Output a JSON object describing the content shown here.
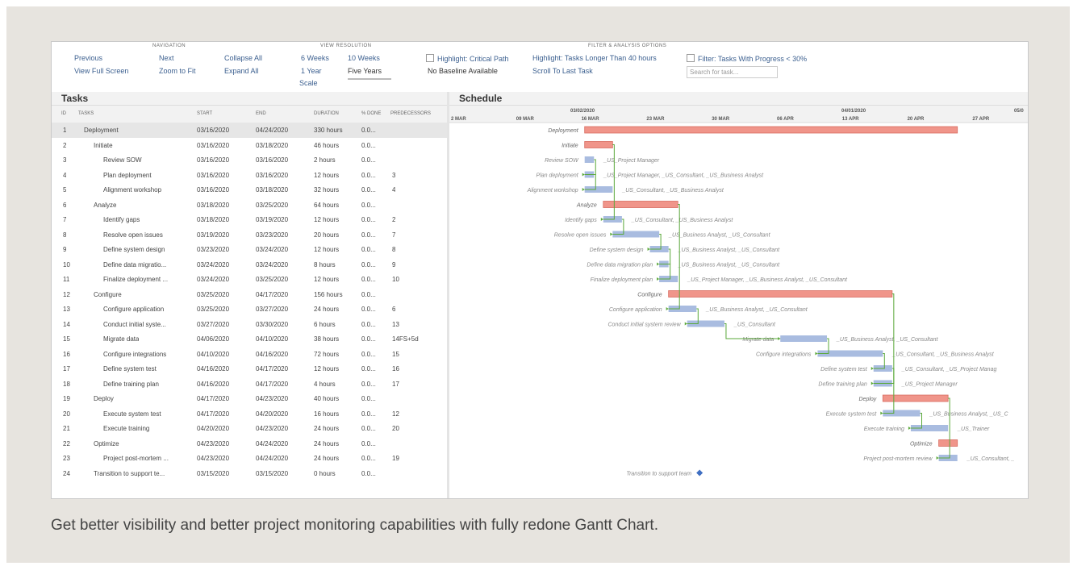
{
  "toolbar": {
    "navigation_title": "NAVIGATION",
    "previous": "Previous",
    "next": "Next",
    "view_full_screen": "View Full Screen",
    "zoom_to_fit": "Zoom to Fit",
    "collapse_all": "Collapse All",
    "expand_all": "Expand All",
    "view_resolution_title": "VIEW RESOLUTION",
    "six_weeks": "6 Weeks",
    "ten_weeks": "10 Weeks",
    "one_year": "1 Year",
    "five_years": "Five Years",
    "scale": "Scale",
    "filter_title": "FILTER & ANALYSIS OPTIONS",
    "highlight_critical": "Highlight: Critical Path",
    "highlight_longer": "Highlight: Tasks Longer Than 40 hours",
    "filter_progress": "Filter: Tasks With Progress < 30%",
    "no_baseline": "No Baseline Available",
    "scroll_last_task": "Scroll To Last Task",
    "search_placeholder": "Search for task..."
  },
  "tasks_header": "Tasks",
  "schedule_header": "Schedule",
  "columns": {
    "id": "ID",
    "tasks": "TASKS",
    "start": "START",
    "end": "END",
    "duration": "DURATION",
    "pct": "% DONE",
    "pred": "PREDECESSORS"
  },
  "tasks": [
    {
      "id": "1",
      "name": "Deployment",
      "indent": 0,
      "start": "03/16/2020",
      "end": "04/24/2020",
      "duration": "330 hours",
      "pct": "0.0...",
      "pred": ""
    },
    {
      "id": "2",
      "name": "Initiate",
      "indent": 1,
      "start": "03/16/2020",
      "end": "03/18/2020",
      "duration": "46 hours",
      "pct": "0.0...",
      "pred": ""
    },
    {
      "id": "3",
      "name": "Review SOW",
      "indent": 2,
      "start": "03/16/2020",
      "end": "03/16/2020",
      "duration": "2 hours",
      "pct": "0.0...",
      "pred": ""
    },
    {
      "id": "4",
      "name": "Plan deployment",
      "indent": 2,
      "start": "03/16/2020",
      "end": "03/16/2020",
      "duration": "12 hours",
      "pct": "0.0...",
      "pred": "3"
    },
    {
      "id": "5",
      "name": "Alignment workshop",
      "indent": 2,
      "start": "03/16/2020",
      "end": "03/18/2020",
      "duration": "32 hours",
      "pct": "0.0...",
      "pred": "4"
    },
    {
      "id": "6",
      "name": "Analyze",
      "indent": 1,
      "start": "03/18/2020",
      "end": "03/25/2020",
      "duration": "64 hours",
      "pct": "0.0...",
      "pred": ""
    },
    {
      "id": "7",
      "name": "Identify gaps",
      "indent": 2,
      "start": "03/18/2020",
      "end": "03/19/2020",
      "duration": "12 hours",
      "pct": "0.0...",
      "pred": "2"
    },
    {
      "id": "8",
      "name": "Resolve open issues",
      "indent": 2,
      "start": "03/19/2020",
      "end": "03/23/2020",
      "duration": "20 hours",
      "pct": "0.0...",
      "pred": "7"
    },
    {
      "id": "9",
      "name": "Define system design",
      "indent": 2,
      "start": "03/23/2020",
      "end": "03/24/2020",
      "duration": "12 hours",
      "pct": "0.0...",
      "pred": "8"
    },
    {
      "id": "10",
      "name": "Define data migratio...",
      "indent": 2,
      "start": "03/24/2020",
      "end": "03/24/2020",
      "duration": "8 hours",
      "pct": "0.0...",
      "pred": "9"
    },
    {
      "id": "11",
      "name": "Finalize deployment ...",
      "indent": 2,
      "start": "03/24/2020",
      "end": "03/25/2020",
      "duration": "12 hours",
      "pct": "0.0...",
      "pred": "10"
    },
    {
      "id": "12",
      "name": "Configure",
      "indent": 1,
      "start": "03/25/2020",
      "end": "04/17/2020",
      "duration": "156 hours",
      "pct": "0.0...",
      "pred": ""
    },
    {
      "id": "13",
      "name": "Configure application",
      "indent": 2,
      "start": "03/25/2020",
      "end": "03/27/2020",
      "duration": "24 hours",
      "pct": "0.0...",
      "pred": "6"
    },
    {
      "id": "14",
      "name": "Conduct initial syste...",
      "indent": 2,
      "start": "03/27/2020",
      "end": "03/30/2020",
      "duration": "6 hours",
      "pct": "0.0...",
      "pred": "13"
    },
    {
      "id": "15",
      "name": "Migrate data",
      "indent": 2,
      "start": "04/06/2020",
      "end": "04/10/2020",
      "duration": "38 hours",
      "pct": "0.0...",
      "pred": "14FS+5d"
    },
    {
      "id": "16",
      "name": "Configure integrations",
      "indent": 2,
      "start": "04/10/2020",
      "end": "04/16/2020",
      "duration": "72 hours",
      "pct": "0.0...",
      "pred": "15"
    },
    {
      "id": "17",
      "name": "Define system test",
      "indent": 2,
      "start": "04/16/2020",
      "end": "04/17/2020",
      "duration": "12 hours",
      "pct": "0.0...",
      "pred": "16"
    },
    {
      "id": "18",
      "name": "Define training plan",
      "indent": 2,
      "start": "04/16/2020",
      "end": "04/17/2020",
      "duration": "4 hours",
      "pct": "0.0...",
      "pred": "17"
    },
    {
      "id": "19",
      "name": "Deploy",
      "indent": 1,
      "start": "04/17/2020",
      "end": "04/23/2020",
      "duration": "40 hours",
      "pct": "0.0...",
      "pred": ""
    },
    {
      "id": "20",
      "name": "Execute system test",
      "indent": 2,
      "start": "04/17/2020",
      "end": "04/20/2020",
      "duration": "16 hours",
      "pct": "0.0...",
      "pred": "12"
    },
    {
      "id": "21",
      "name": "Execute training",
      "indent": 2,
      "start": "04/20/2020",
      "end": "04/23/2020",
      "duration": "24 hours",
      "pct": "0.0...",
      "pred": "20"
    },
    {
      "id": "22",
      "name": "Optimize",
      "indent": 1,
      "start": "04/23/2020",
      "end": "04/24/2020",
      "duration": "24 hours",
      "pct": "0.0...",
      "pred": ""
    },
    {
      "id": "23",
      "name": "Project post-mortem ...",
      "indent": 2,
      "start": "04/23/2020",
      "end": "04/24/2020",
      "duration": "24 hours",
      "pct": "0.0...",
      "pred": "19"
    },
    {
      "id": "24",
      "name": "Transition to support te...",
      "indent": 1,
      "start": "03/15/2020",
      "end": "03/15/2020",
      "duration": "0 hours",
      "pct": "0.0...",
      "pred": ""
    }
  ],
  "schedule": {
    "month_labels": [
      "03/02/2020",
      "04/01/2020",
      "05/0"
    ],
    "week_labels": [
      "2 MAR",
      "09 MAR",
      "16 MAR",
      "23 MAR",
      "30 MAR",
      "06 APR",
      "13 APR",
      "20 APR",
      "27 APR"
    ],
    "bars": [
      {
        "label": "Deployment",
        "start": "03/16/2020",
        "end": "04/24/2020",
        "summary": true,
        "resources": ""
      },
      {
        "label": "Initiate",
        "start": "03/16/2020",
        "end": "03/18/2020",
        "summary": true,
        "resources": ""
      },
      {
        "label": "Review SOW",
        "start": "03/16/2020",
        "end": "03/16/2020",
        "summary": false,
        "resources": "_US_Project Manager"
      },
      {
        "label": "Plan deployment",
        "start": "03/16/2020",
        "end": "03/16/2020",
        "summary": false,
        "resources": "_US_Project Manager, _US_Consultant, _US_Business Analyst"
      },
      {
        "label": "Alignment workshop",
        "start": "03/16/2020",
        "end": "03/18/2020",
        "summary": false,
        "resources": "_US_Consultant, _US_Business Analyst"
      },
      {
        "label": "Analyze",
        "start": "03/18/2020",
        "end": "03/25/2020",
        "summary": true,
        "resources": ""
      },
      {
        "label": "Identify gaps",
        "start": "03/18/2020",
        "end": "03/19/2020",
        "summary": false,
        "resources": "_US_Consultant, _US_Business Analyst"
      },
      {
        "label": "Resolve open issues",
        "start": "03/19/2020",
        "end": "03/23/2020",
        "summary": false,
        "resources": "_US_Business Analyst, _US_Consultant"
      },
      {
        "label": "Define system design",
        "start": "03/23/2020",
        "end": "03/24/2020",
        "summary": false,
        "resources": "_US_Business Analyst, _US_Consultant"
      },
      {
        "label": "Define data migration plan",
        "start": "03/24/2020",
        "end": "03/24/2020",
        "summary": false,
        "resources": "_US_Business Analyst, _US_Consultant"
      },
      {
        "label": "Finalize deployment plan",
        "start": "03/24/2020",
        "end": "03/25/2020",
        "summary": false,
        "resources": "_US_Project Manager, _US_Business Analyst, _US_Consultant"
      },
      {
        "label": "Configure",
        "start": "03/25/2020",
        "end": "04/17/2020",
        "summary": true,
        "resources": ""
      },
      {
        "label": "Configure application",
        "start": "03/25/2020",
        "end": "03/27/2020",
        "summary": false,
        "resources": "_US_Business Analyst, _US_Consultant"
      },
      {
        "label": "Conduct initial system review",
        "start": "03/27/2020",
        "end": "03/30/2020",
        "summary": false,
        "resources": "_US_Consultant"
      },
      {
        "label": "Migrate data",
        "start": "04/06/2020",
        "end": "04/10/2020",
        "summary": false,
        "resources": "_US_Business Analyst, _US_Consultant"
      },
      {
        "label": "Configure integrations",
        "start": "04/10/2020",
        "end": "04/16/2020",
        "summary": false,
        "resources": "_US_Consultant, _US_Business Analyst"
      },
      {
        "label": "Define system test",
        "start": "04/16/2020",
        "end": "04/17/2020",
        "summary": false,
        "resources": "_US_Consultant, _US_Project Manag"
      },
      {
        "label": "Define training plan",
        "start": "04/16/2020",
        "end": "04/17/2020",
        "summary": false,
        "resources": "_US_Project Manager"
      },
      {
        "label": "Deploy",
        "start": "04/17/2020",
        "end": "04/23/2020",
        "summary": true,
        "resources": ""
      },
      {
        "label": "Execute system test",
        "start": "04/17/2020",
        "end": "04/20/2020",
        "summary": false,
        "resources": "_US_Business Analyst, _US_C"
      },
      {
        "label": "Execute training",
        "start": "04/20/2020",
        "end": "04/23/2020",
        "summary": false,
        "resources": "_US_Trainer"
      },
      {
        "label": "Optimize",
        "start": "04/23/2020",
        "end": "04/24/2020",
        "summary": true,
        "resources": ""
      },
      {
        "label": "Project post-mortem review",
        "start": "04/23/2020",
        "end": "04/24/2020",
        "summary": false,
        "resources": "_US_Consultant, _"
      },
      {
        "label": "Transition to support team",
        "start": "03/15/2020",
        "end": "03/15/2020",
        "summary": false,
        "milestone": true,
        "resources": ""
      }
    ]
  },
  "colors": {
    "summary_bar": "#f0958a",
    "summary_border": "#d96b5f",
    "task_bar": "#a9bce0",
    "dependency_line": "#5aa83a",
    "milestone": "#3f6fc2"
  },
  "caption": "Get better visibility and better project monitoring capabilities with fully redone Gantt Chart."
}
